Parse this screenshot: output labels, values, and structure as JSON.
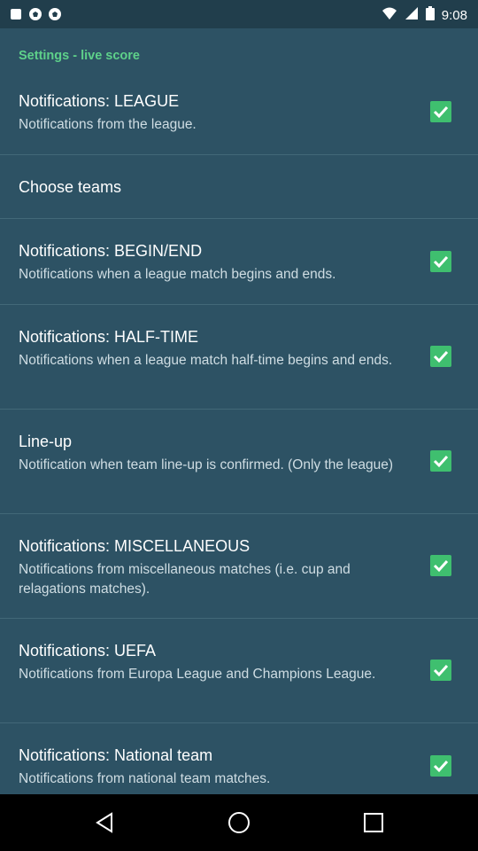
{
  "status_bar": {
    "time": "9:08",
    "icons": [
      "app-notification-icon",
      "soccer-ball-icon",
      "soccer-ball-icon",
      "wifi-icon",
      "signal-icon",
      "battery-icon"
    ]
  },
  "header": {
    "section_title": "Settings - live score"
  },
  "prefs": [
    {
      "title": "Notifications: LEAGUE",
      "summary": "Notifications from the league.",
      "checked": true
    },
    {
      "title": "Choose teams",
      "summary": "",
      "checked": null
    },
    {
      "title": "Notifications: BEGIN/END",
      "summary": "Notifications when a league match begins and ends.",
      "checked": true
    },
    {
      "title": "Notifications: HALF-TIME",
      "summary": "Notifications when a league match half-time begins and ends.",
      "checked": true
    },
    {
      "title": "Line-up",
      "summary": "Notification when team line-up is confirmed. (Only the league)",
      "checked": true
    },
    {
      "title": "Notifications: MISCELLANEOUS",
      "summary": "Notifications from miscellaneous matches (i.e. cup and relagations matches).",
      "checked": true
    },
    {
      "title": "Notifications: UEFA",
      "summary": "Notifications from Europa League and Champions League.",
      "checked": true
    },
    {
      "title": "Notifications: National team",
      "summary": "Notifications from national team matches.",
      "checked": true
    }
  ],
  "colors": {
    "accent": "#3fbf6f",
    "section_title": "#5ed18a",
    "background": "#2d5264"
  },
  "nav": {
    "buttons": [
      "back-icon",
      "home-icon",
      "recents-icon"
    ]
  }
}
